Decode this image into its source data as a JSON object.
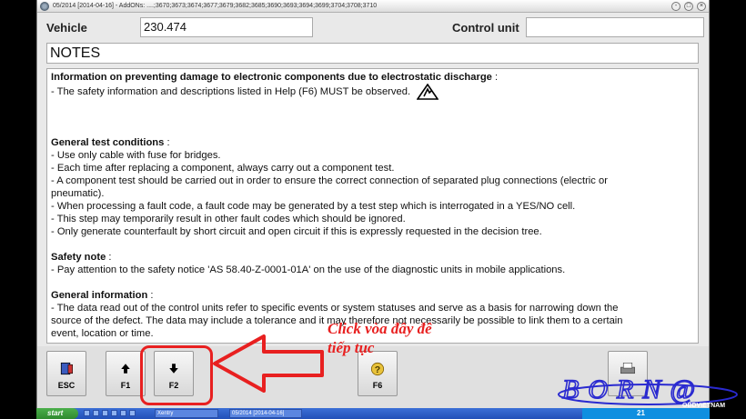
{
  "window": {
    "title": "05/2014 [2014-04-16] - AddONs: ....;3670;3673;3674;3677;3679;3682;3685;3690;3693;3694;3699;3704;3708;3710",
    "minimize_glyph": "-",
    "restore_glyph": "□",
    "close_glyph": "×"
  },
  "fields": {
    "vehicle_label": "Vehicle",
    "vehicle_value": "230.474",
    "control_unit_label": "Control unit",
    "control_unit_value": ""
  },
  "notes_title": "NOTES",
  "sections": {
    "esd": {
      "heading": "Information on preventing damage to electronic components due to electrostatic discharge",
      "heading_suffix": " :",
      "lines": [
        "- The safety information and descriptions listed in Help (F6) MUST be observed."
      ]
    },
    "general_test": {
      "heading": "General test conditions",
      "heading_suffix": " :",
      "lines": [
        "- Use only cable with fuse for bridges.",
        "- Each time after replacing a component, always carry out a component test.",
        "- A component test should be carried out in order to ensure the correct connection of separated plug connections (electric or",
        "  pneumatic).",
        "- When processing a fault code, a fault code may be generated by a test step which is interrogated in a YES/NO cell.",
        "- This step may temporarily result in other fault codes which should be ignored.",
        "- Only generate counterfault by short circuit and open circuit if this is expressly requested in the decision tree."
      ]
    },
    "safety": {
      "heading": "Safety note",
      "heading_suffix": " :",
      "lines": [
        "- Pay attention to the safety notice 'AS 58.40-Z-0001-01A' on the use of the diagnostic units in mobile applications."
      ]
    },
    "general_info": {
      "heading": "General information",
      "heading_suffix": " :",
      "lines": [
        "- The data read out of the control units refer to specific events or system statuses and serve as a basis for narrowing down the",
        "  source of the defect. The data may include a tolerance and it may therefore not necessarily be possible to link them to a certain",
        "  event, location or time."
      ]
    }
  },
  "toolbar": {
    "esc_label": "ESC",
    "f1_label": "F1",
    "f2_label": "F2",
    "f6_label": "F6",
    "esc_icon": "exit-door-icon",
    "f1_icon": "arrow-up-icon",
    "f2_icon": "arrow-down-icon",
    "f6_icon": "help-question-icon",
    "print_icon": "printer-icon"
  },
  "annotation": {
    "line1": "Click vòa đây đê",
    "line2": "tiếp tục",
    "color": "#e82020"
  },
  "taskbar": {
    "start_label": "start",
    "task1": "05/2014 [2014-04-16]",
    "task2": "Xentry",
    "tray_time": "21"
  },
  "logo": {
    "text": "BORN@",
    "subtext": "OBDVIETNAM"
  }
}
